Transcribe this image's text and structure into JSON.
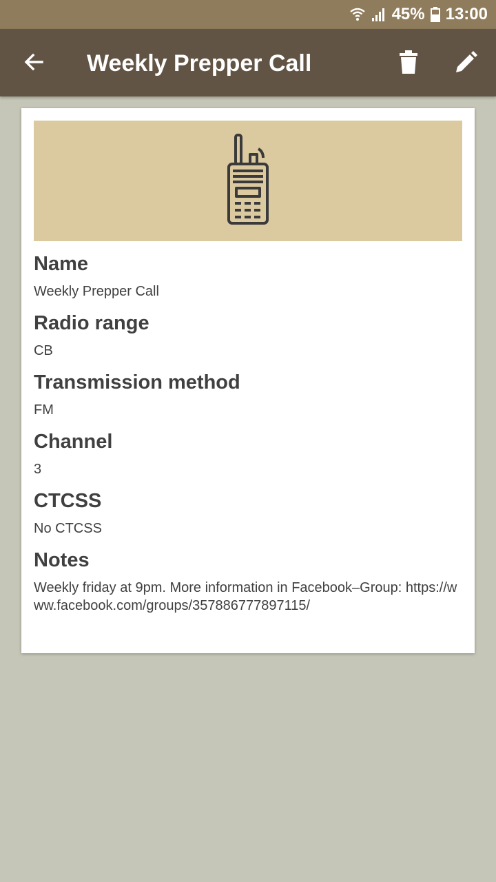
{
  "status_bar": {
    "battery_percent": "45%",
    "time": "13:00",
    "icons": [
      "wifi-icon",
      "signal-icon",
      "battery-icon"
    ]
  },
  "app_bar": {
    "title": "Weekly Prepper Call",
    "icons": [
      "back-arrow-icon",
      "trash-icon",
      "pencil-icon"
    ]
  },
  "card": {
    "icon": "walkie-talkie-icon",
    "fields": [
      {
        "label": "Name",
        "value": "Weekly Prepper Call"
      },
      {
        "label": "Radio range",
        "value": "CB"
      },
      {
        "label": "Transmission method",
        "value": "FM"
      },
      {
        "label": "Channel",
        "value": "3"
      },
      {
        "label": "CTCSS",
        "value": "No CTCSS"
      },
      {
        "label": "Notes",
        "value": "Weekly friday at 9pm. More information in Facebook–Group: https://www.facebook.com/groups/357886777897115/"
      }
    ]
  },
  "colors": {
    "status_bar": "#8f7c5c",
    "app_bar": "#625444",
    "background": "#c5c6b7",
    "banner": "#dbc9a0",
    "text": "#404040"
  }
}
